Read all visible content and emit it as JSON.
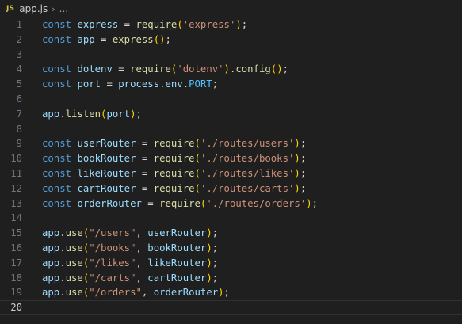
{
  "breadcrumb": {
    "icon_text": "JS",
    "file": "app.js",
    "separator": "›",
    "ellipsis": "..."
  },
  "gutter": {
    "line_numbers": [
      "1",
      "2",
      "3",
      "4",
      "5",
      "6",
      "7",
      "8",
      "9",
      "10",
      "11",
      "12",
      "13",
      "14",
      "15",
      "16",
      "17",
      "18",
      "19",
      "20"
    ],
    "current_line": "20"
  },
  "code": {
    "l1": {
      "kw": "const",
      "var": "express",
      "op": " = ",
      "fn": "require",
      "b1": "(",
      "str": "'express'",
      "b2": ")",
      "end": ";"
    },
    "l2": {
      "kw": "const",
      "var": "app",
      "op": " = ",
      "fn": "express",
      "b1": "(",
      "b2": ")",
      "end": ";"
    },
    "l4": {
      "kw": "const",
      "var": "dotenv",
      "op": " = ",
      "fn": "require",
      "b1": "(",
      "str": "'dotenv'",
      "b2": ")",
      "dot": ".",
      "fn2": "config",
      "b3": "(",
      "b4": ")",
      "end": ";"
    },
    "l5": {
      "kw": "const",
      "var": "port",
      "op": " = ",
      "obj": "process",
      "dot1": ".",
      "prop": "env",
      "dot2": ".",
      "const": "PORT",
      "end": ";"
    },
    "l7": {
      "var": "app",
      "dot": ".",
      "fn": "listen",
      "b1": "(",
      "arg": "port",
      "b2": ")",
      "end": ";"
    },
    "l9": {
      "kw": "const",
      "var": "userRouter",
      "op": " = ",
      "fn": "require",
      "b1": "(",
      "str": "'./routes/users'",
      "b2": ")",
      "end": ";"
    },
    "l10": {
      "kw": "const",
      "var": "bookRouter",
      "op": " = ",
      "fn": "require",
      "b1": "(",
      "str": "'./routes/books'",
      "b2": ")",
      "end": ";"
    },
    "l11": {
      "kw": "const",
      "var": "likeRouter",
      "op": " = ",
      "fn": "require",
      "b1": "(",
      "str": "'./routes/likes'",
      "b2": ")",
      "end": ";"
    },
    "l12": {
      "kw": "const",
      "var": "cartRouter",
      "op": " = ",
      "fn": "require",
      "b1": "(",
      "str": "'./routes/carts'",
      "b2": ")",
      "end": ";"
    },
    "l13": {
      "kw": "const",
      "var": "orderRouter",
      "op": " = ",
      "fn": "require",
      "b1": "(",
      "str": "'./routes/orders'",
      "b2": ")",
      "end": ";"
    },
    "l15": {
      "var": "app",
      "dot": ".",
      "fn": "use",
      "b1": "(",
      "str": "\"/users\"",
      "comma": ", ",
      "arg": "userRouter",
      "b2": ")",
      "end": ";"
    },
    "l16": {
      "var": "app",
      "dot": ".",
      "fn": "use",
      "b1": "(",
      "str": "\"/books\"",
      "comma": ", ",
      "arg": "bookRouter",
      "b2": ")",
      "end": ";"
    },
    "l17": {
      "var": "app",
      "dot": ".",
      "fn": "use",
      "b1": "(",
      "str": "\"/likes\"",
      "comma": ", ",
      "arg": "likeRouter",
      "b2": ")",
      "end": ";"
    },
    "l18": {
      "var": "app",
      "dot": ".",
      "fn": "use",
      "b1": "(",
      "str": "\"/carts\"",
      "comma": ", ",
      "arg": "cartRouter",
      "b2": ")",
      "end": ";"
    },
    "l19": {
      "var": "app",
      "dot": ".",
      "fn": "use",
      "b1": "(",
      "str": "\"/orders\"",
      "comma": ", ",
      "arg": "orderRouter",
      "b2": ")",
      "end": ";"
    }
  },
  "colors": {
    "background": "#1f1f1f",
    "keyword": "#569cd6",
    "variable": "#9cdcfe",
    "function": "#dcdcaa",
    "string": "#ce9178",
    "constant": "#4fc1ff",
    "bracket": "#ffd700",
    "bracket_nested": "#da70d6",
    "line_number": "#6e7681"
  }
}
